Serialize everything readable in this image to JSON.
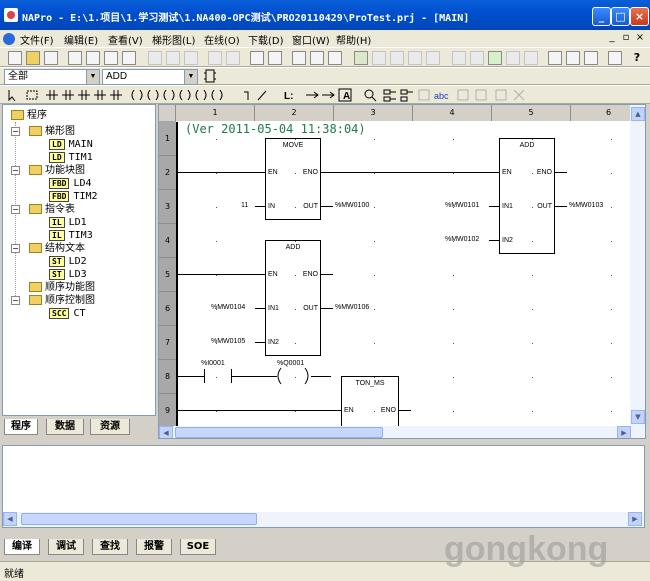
{
  "window": {
    "title": "NAPro - E:\\1.项目\\1.学习测试\\1.NA400-OPC测试\\PRO20110429\\ProTest.prj - [MAIN]",
    "controls": [
      "_",
      "□",
      "×"
    ]
  },
  "menubar": {
    "items": [
      "文件(F)",
      "编辑(E)",
      "查看(V)",
      "梯形图(L)",
      "在线(O)",
      "下载(D)",
      "窗口(W)",
      "帮助(H)"
    ],
    "mdi_controls": [
      "_",
      "▫",
      "×"
    ]
  },
  "toolbar3": {
    "scope_combo": "全部",
    "instr_combo": "ADD"
  },
  "tree": {
    "root": "程序",
    "groups": [
      {
        "label": "梯形图",
        "items": [
          {
            "badge": "LD",
            "name": "MAIN"
          },
          {
            "badge": "LD",
            "name": "TIM1"
          }
        ]
      },
      {
        "label": "功能块图",
        "items": [
          {
            "badge": "FBD",
            "name": "LD4"
          },
          {
            "badge": "FBD",
            "name": "TIM2"
          }
        ]
      },
      {
        "label": "指令表",
        "items": [
          {
            "badge": "IL",
            "name": "LD1"
          },
          {
            "badge": "IL",
            "name": "TIM3"
          }
        ]
      },
      {
        "label": "结构文本",
        "items": [
          {
            "badge": "ST",
            "name": "LD2"
          },
          {
            "badge": "ST",
            "name": "LD3"
          }
        ]
      },
      {
        "label": "顺序功能图",
        "items": []
      },
      {
        "label": "顺序控制图",
        "items": [
          {
            "badge": "SCC",
            "name": "CT"
          }
        ]
      }
    ]
  },
  "left_tabs": [
    "程序",
    "数据",
    "资源"
  ],
  "ladder": {
    "version_line": "(Ver 2011-05-04 11:38:04)",
    "column_headers": [
      "1",
      "2",
      "3",
      "4",
      "5",
      "6"
    ],
    "row_numbers": [
      "1",
      "2",
      "3",
      "4",
      "5",
      "6",
      "7",
      "8",
      "9"
    ],
    "blocks": [
      {
        "id": "move1",
        "name": "MOVE",
        "pins": {
          "en": "EN",
          "eno": "ENO",
          "in": "IN",
          "out": "OUT"
        }
      },
      {
        "id": "add1",
        "name": "ADD",
        "pins": {
          "en": "EN",
          "eno": "ENO",
          "in1": "IN1",
          "out": "OUT",
          "in2": "IN2"
        }
      },
      {
        "id": "add2",
        "name": "ADD",
        "pins": {
          "en": "EN",
          "eno": "ENO",
          "in1": "IN1",
          "out": "OUT",
          "in2": "IN2"
        }
      },
      {
        "id": "ton1",
        "name": "TON_MS",
        "pins": {
          "en": "EN",
          "eno": "ENO"
        }
      }
    ],
    "operands": {
      "move_in": "11",
      "move_out": "%MW0100",
      "add1_in1": "%MW0101",
      "add1_out": "%MW0103",
      "add1_in2": "%MW0102",
      "add2_in1": "%MW0104",
      "add2_out": "%MW0106",
      "add2_in2": "%MW0105",
      "contact": "%I0001",
      "coil": "%Q0001"
    }
  },
  "bottom_tabs": [
    "编译",
    "调试",
    "查找",
    "报警",
    "SOE"
  ],
  "status": {
    "text": "就绪"
  },
  "watermark": "gongkong"
}
